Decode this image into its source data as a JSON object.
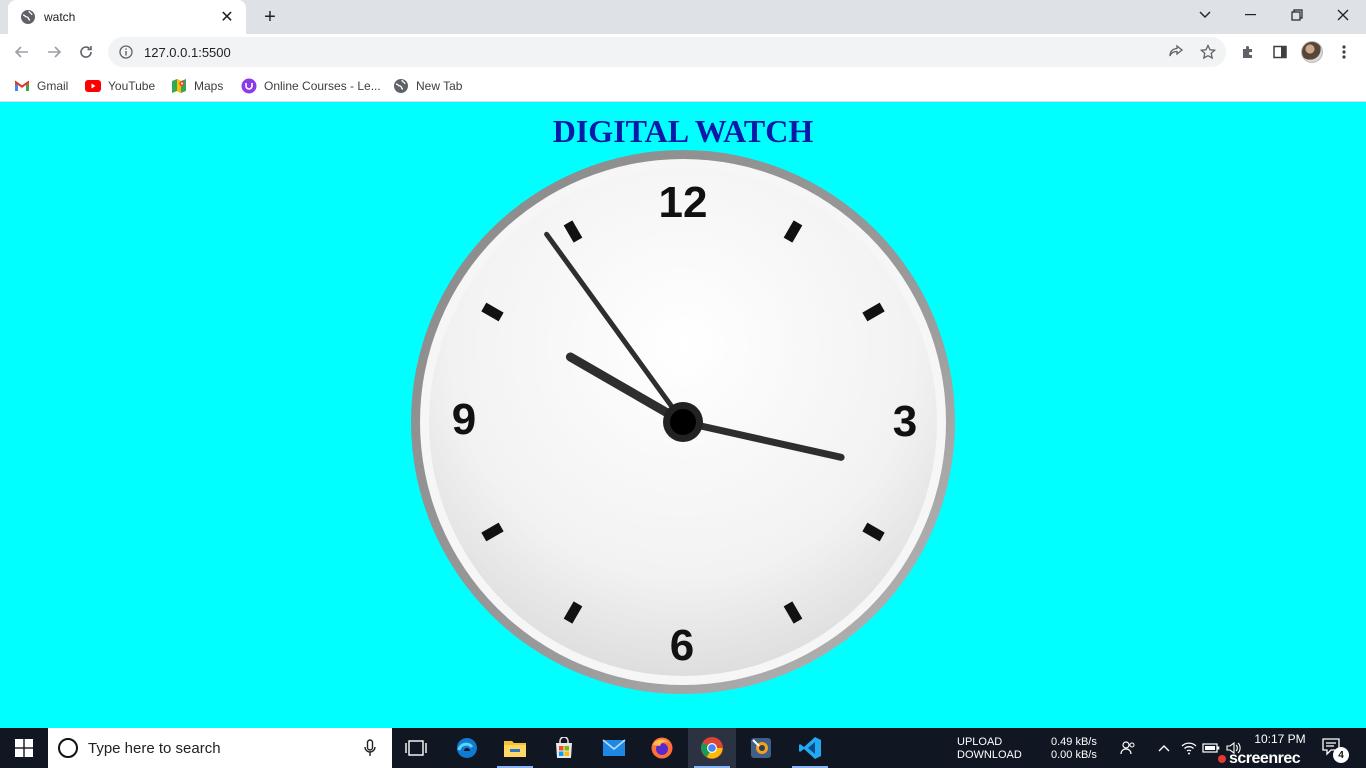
{
  "browser": {
    "tab_title": "watch",
    "url": "127.0.0.1:5500",
    "bookmarks": [
      {
        "label": "Gmail",
        "icon": "gmail-icon"
      },
      {
        "label": "YouTube",
        "icon": "youtube-icon"
      },
      {
        "label": "Maps",
        "icon": "maps-icon"
      },
      {
        "label": "Online Courses - Le...",
        "icon": "courses-icon"
      },
      {
        "label": "New Tab",
        "icon": "globe-icon"
      }
    ]
  },
  "page": {
    "title": "DIGITAL WATCH",
    "clock": {
      "numerals": [
        "12",
        "3",
        "6",
        "9"
      ],
      "hour_hand_hours": 10.0,
      "minute_hand_minutes": 17,
      "second_hand_seconds": 54,
      "colors": {
        "background": "#00ffff",
        "title": "#0a1aa8",
        "face": "#f4f4f4",
        "rim": "#8e8e8e",
        "hands": "#2e2e2e"
      }
    }
  },
  "taskbar": {
    "search_placeholder": "Type here to search",
    "network": {
      "upload_label": "UPLOAD",
      "download_label": "DOWNLOAD",
      "upload_rate": "0.49 kB/s",
      "download_rate": "0.00 kB/s"
    },
    "time": "10:17 PM",
    "watermark": "screenrec",
    "notification_count": "4"
  }
}
